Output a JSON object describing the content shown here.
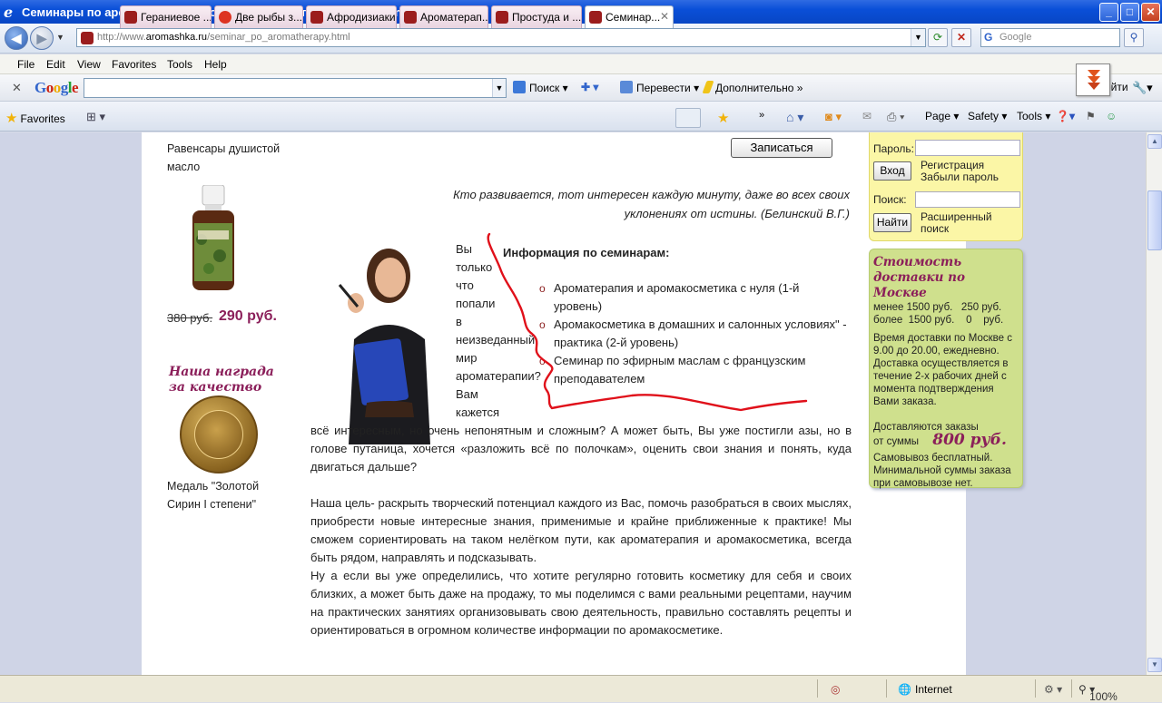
{
  "window": {
    "title": "Семинары по ароматерапии и домашней косметике - Windows Internet Explorer",
    "min_label": "_",
    "max_label": "□",
    "close_label": "✕"
  },
  "address": {
    "url_prefix": "http://www.",
    "url_host": "aromashka.ru",
    "url_path": "/seminar_po_aromatherapy.html",
    "search_placeholder": "Google",
    "search_g": "G"
  },
  "menu": [
    "File",
    "Edit",
    "View",
    "Favorites",
    "Tools",
    "Help"
  ],
  "google_toolbar": {
    "logo": "Google",
    "search_btn": "Поиск",
    "translate": "Перевести",
    "more": "Дополнительно »",
    "signin": "Войти"
  },
  "favorites_bar": {
    "label": "Favorites",
    "tabs": [
      {
        "label": "Гераниевое ..."
      },
      {
        "label": "Две рыбы з..."
      },
      {
        "label": "Афродизиаки"
      },
      {
        "label": "Ароматерап..."
      },
      {
        "label": "Простуда и ..."
      },
      {
        "label": "Семинар..."
      }
    ],
    "commands": [
      "Page",
      "Safety",
      "Tools"
    ]
  },
  "left_column": {
    "product_name": "Равенсары душистой масло",
    "old_price": "380 руб.",
    "new_price": "290 руб.",
    "award_title": "Наша награда за качество",
    "medal_caption": "Медаль \"Золотой Сирин I степени\""
  },
  "main": {
    "signup_button": "Записаться",
    "quote": "Кто развивается, тот интересен каждую минуту, даже во всех своих уклонениях от истины. (Белинский В.Г.)",
    "narrow_words": [
      "Вы",
      "только",
      "что",
      "попали",
      "в",
      "неизведанный",
      "мир",
      "ароматерапии?",
      "Вам",
      "кажется"
    ],
    "info_title": "Информация по семинарам:",
    "seminars": [
      "Ароматерапия и аромакосметика с нуля (1-й уровень)",
      "Аромакосметика в домашних и салонных условиях\" - практика (2-й уровень)",
      "Семинар по эфирным маслам с французским преподавателем"
    ],
    "para1": "всё интересным, но очень непонятным и сложным? А может быть, Вы уже постигли азы, но в голове путаница, хочется «разложить всё по полочкам», оценить свои знания и понять, куда двигаться дальше?",
    "para2": "Наша цель- раскрыть творческий потенциал каждого из Вас, помочь разобраться в своих мыслях, приобрести новые интересные знания, применимые и крайне приближенные к практике! Мы сможем сориентировать на таком нелёгком пути, как ароматерапия и аромакосметика, всегда быть рядом, направлять и подсказывать.",
    "para3": "Ну а если вы уже определились, что хотите регулярно готовить косметику для себя и своих близких, а может быть даже на продажу, то мы поделимся с вами реальными рецептами, научим на практических занятиях организовывать свою деятельность, правильно составлять рецепты и ориентироваться в огромном количестве информации по аромакосметике."
  },
  "sidebar": {
    "password_label": "Пароль:",
    "login_button": "Вход",
    "register_link": "Регистрация",
    "forgot_link": "Забыли пароль",
    "search_label": "Поиск:",
    "find_button": "Найти",
    "advanced_search": "Расширенный поиск",
    "delivery_title": "Стоимость доставки по Москве",
    "delivery_rows": [
      "менее 1500 руб.   250 руб.",
      "более  1500 руб.    0    руб."
    ],
    "delivery_time": "Время доставки по Москве с 9.00 до 20.00, ежедневно. Доставка осуществляется в течение 2-х рабочих дней с момента подтверждения Вами заказа.",
    "min_order_text1": "Доставляются заказы",
    "min_order_text2": "от суммы",
    "min_order_amount": "800 руб.",
    "pickup": "Самовывоз бесплатный. Минимальной суммы заказа при самовывозе нет."
  },
  "status": {
    "zone": "Internet",
    "zoom": "100%"
  },
  "colors": {
    "accent_purple": "#8b1f5a",
    "sidebar_yellow": "#fbf6a6",
    "sidebar_green": "#cfe08d",
    "scribble_red": "#e0101a"
  }
}
